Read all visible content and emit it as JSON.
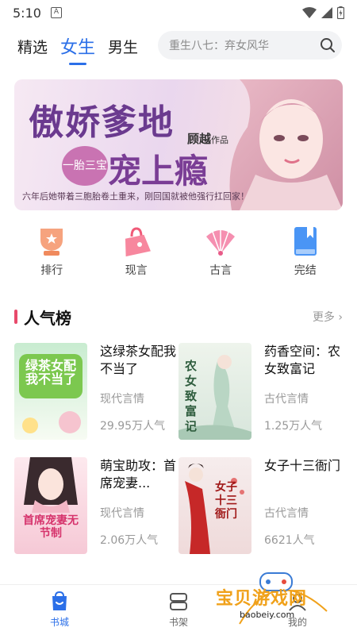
{
  "status_bar": {
    "time": "5:10",
    "notification_letter": "A"
  },
  "header": {
    "tabs": [
      {
        "label": "精选",
        "active": false
      },
      {
        "label": "女生",
        "active": true
      },
      {
        "label": "男生",
        "active": false
      }
    ],
    "search": {
      "placeholder": "重生八七：弃女风华",
      "icon": "search-icon"
    }
  },
  "banner": {
    "title_line1": "傲娇爹地",
    "badge": "一胎三宝",
    "title_line2": "宠上瘾",
    "author": "顾越",
    "author_suffix": "作品",
    "subtitle": "六年后她带着三胞胎卷土重来，刚回国就被他强行扛回家！"
  },
  "categories": [
    {
      "label": "排行",
      "icon": "trophy-icon",
      "color": "#f08a5d"
    },
    {
      "label": "现言",
      "icon": "handbag-icon",
      "color": "#f05a78"
    },
    {
      "label": "古言",
      "icon": "fan-icon",
      "color": "#f27aa0"
    },
    {
      "label": "完结",
      "icon": "bookmark-book-icon",
      "color": "#3f8cf0"
    }
  ],
  "section": {
    "title": "人气榜",
    "more": "更多"
  },
  "books": [
    {
      "title": "这绿茶女配我不当了",
      "genre": "现代言情",
      "popularity": "29.95万人气",
      "cover_text": "绿茶女配我不当了"
    },
    {
      "title": "药香空间：农女致富记",
      "genre": "古代言情",
      "popularity": "1.25万人气",
      "cover_text": "农女致富记"
    },
    {
      "title": "萌宝助攻：首席宠妻...",
      "genre": "现代言情",
      "popularity": "2.06万人气",
      "cover_text": "首席宠妻无节制"
    },
    {
      "title": "女子十三衙门",
      "genre": "古代言情",
      "popularity": "6621人气",
      "cover_text": "女子十三衙门"
    }
  ],
  "bottom_nav": [
    {
      "label": "书城",
      "icon": "bookstore-icon",
      "active": true
    },
    {
      "label": "书架",
      "icon": "bookshelf-icon",
      "active": false
    },
    {
      "label": "我的",
      "icon": "profile-icon",
      "active": false
    }
  ],
  "watermark": {
    "text": "宝贝游戏网",
    "url": "baobeiy.com"
  },
  "colors": {
    "accent": "#2b6fe8",
    "section_bar": "#e84a6b",
    "muted": "#999999"
  }
}
